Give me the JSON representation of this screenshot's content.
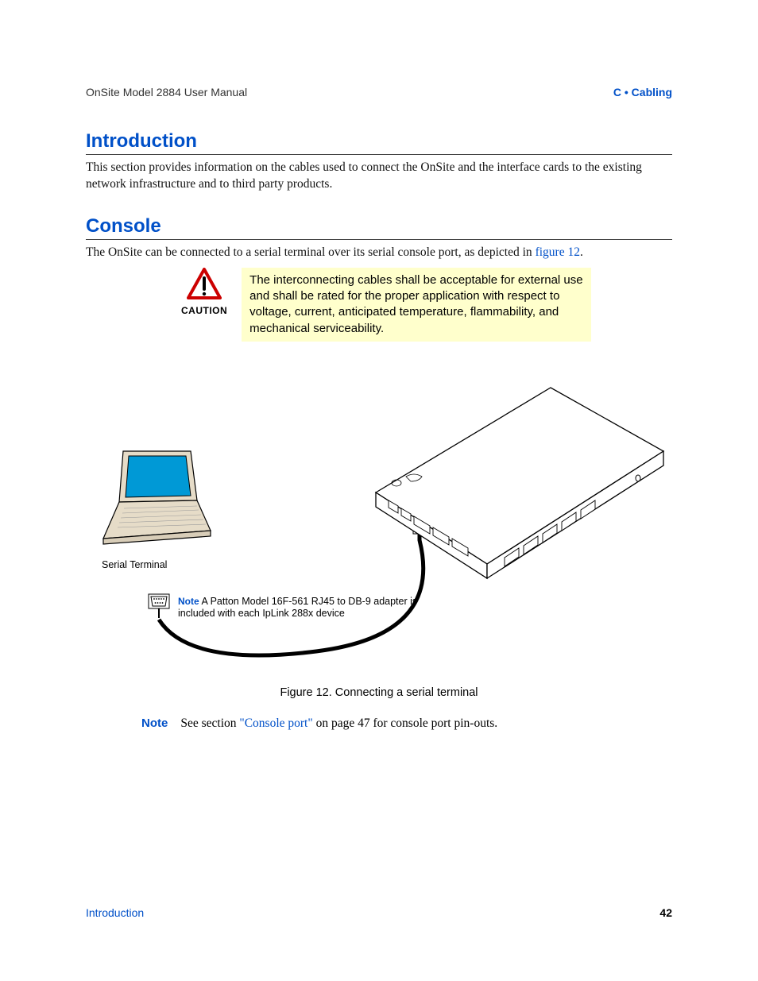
{
  "header": {
    "left": "OnSite Model 2884 User Manual",
    "right": "C • Cabling"
  },
  "sections": {
    "introduction": {
      "heading": "Introduction",
      "body": "This section provides information on the cables used to connect the OnSite and the interface cards to the existing network infrastructure and to third party products."
    },
    "console": {
      "heading": "Console",
      "body_pre": "The OnSite can be connected to a serial terminal over its serial console port, as depicted in ",
      "body_link": "figure 12",
      "body_post": "."
    }
  },
  "caution": {
    "label": "CAUTION",
    "text": "The interconnecting cables shall be acceptable for external use and shall be rated for the proper application with respect to voltage, current, anticipated temperature, flammability, and mechanical serviceability."
  },
  "figure": {
    "serial_terminal_label": "Serial Terminal",
    "inner_note_label": "Note",
    "inner_note_text": "A Patton Model 16F-561 RJ45 to DB-9 adapter is included with each IpLink 288x device",
    "caption": "Figure 12. Connecting a serial terminal"
  },
  "note": {
    "label": "Note",
    "pre": "See section ",
    "link": "\"Console port\"",
    "post": " on page 47 for console port pin-outs."
  },
  "footer": {
    "left": "Introduction",
    "right": "42"
  }
}
